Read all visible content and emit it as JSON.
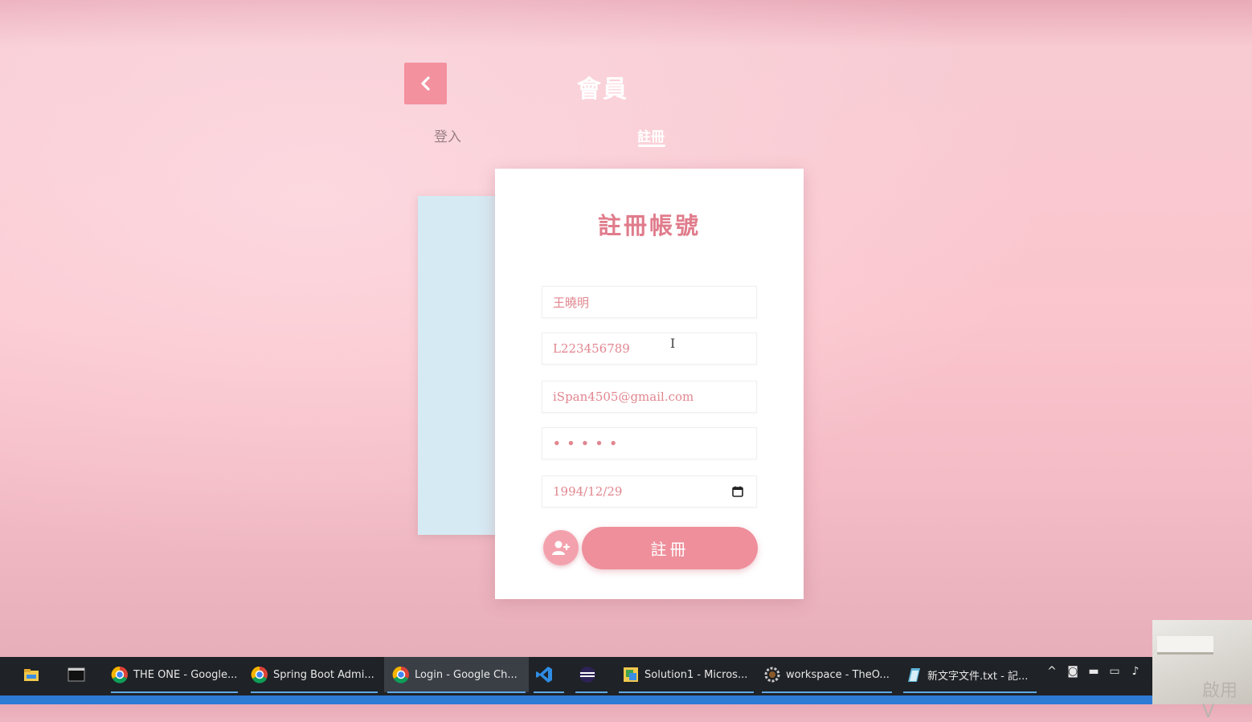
{
  "header": {
    "title": "會員",
    "back_icon": "chevron-left-icon"
  },
  "tabs": [
    {
      "label": "登入",
      "active": false
    },
    {
      "label": "註冊",
      "active": true
    }
  ],
  "form": {
    "heading": "註冊帳號",
    "fields": {
      "name": "王曉明",
      "id_number": "L223456789",
      "email": "iSpan4505@gmail.com",
      "password": "•••••",
      "birthday": "1994/12/29"
    },
    "calendar_icon": "calendar-icon",
    "avatar_icon": "add-user-icon",
    "submit_label": "註冊"
  },
  "taskbar": {
    "items": [
      {
        "label": "",
        "icon": "file-explorer-icon"
      },
      {
        "label": "",
        "icon": "terminal-icon"
      },
      {
        "label": "THE ONE - Google...",
        "icon": "chrome-icon"
      },
      {
        "label": "Spring Boot Admi...",
        "icon": "chrome-icon"
      },
      {
        "label": "Login - Google Ch...",
        "icon": "chrome-icon"
      },
      {
        "label": "",
        "icon": "vscode-icon"
      },
      {
        "label": "",
        "icon": "eclipse-icon"
      },
      {
        "label": "Solution1 - Micros...",
        "icon": "visual-studio-icon"
      },
      {
        "label": "workspace - TheO...",
        "icon": "gear-icon"
      },
      {
        "label": "新文字文件.txt - 記...",
        "icon": "notepad-icon"
      }
    ]
  },
  "webcam": {
    "overlay_text": "啟用 V"
  },
  "colors": {
    "accent": "#ee8f9b",
    "heading": "#e07c8c",
    "back_card": "#d6eaf3"
  }
}
